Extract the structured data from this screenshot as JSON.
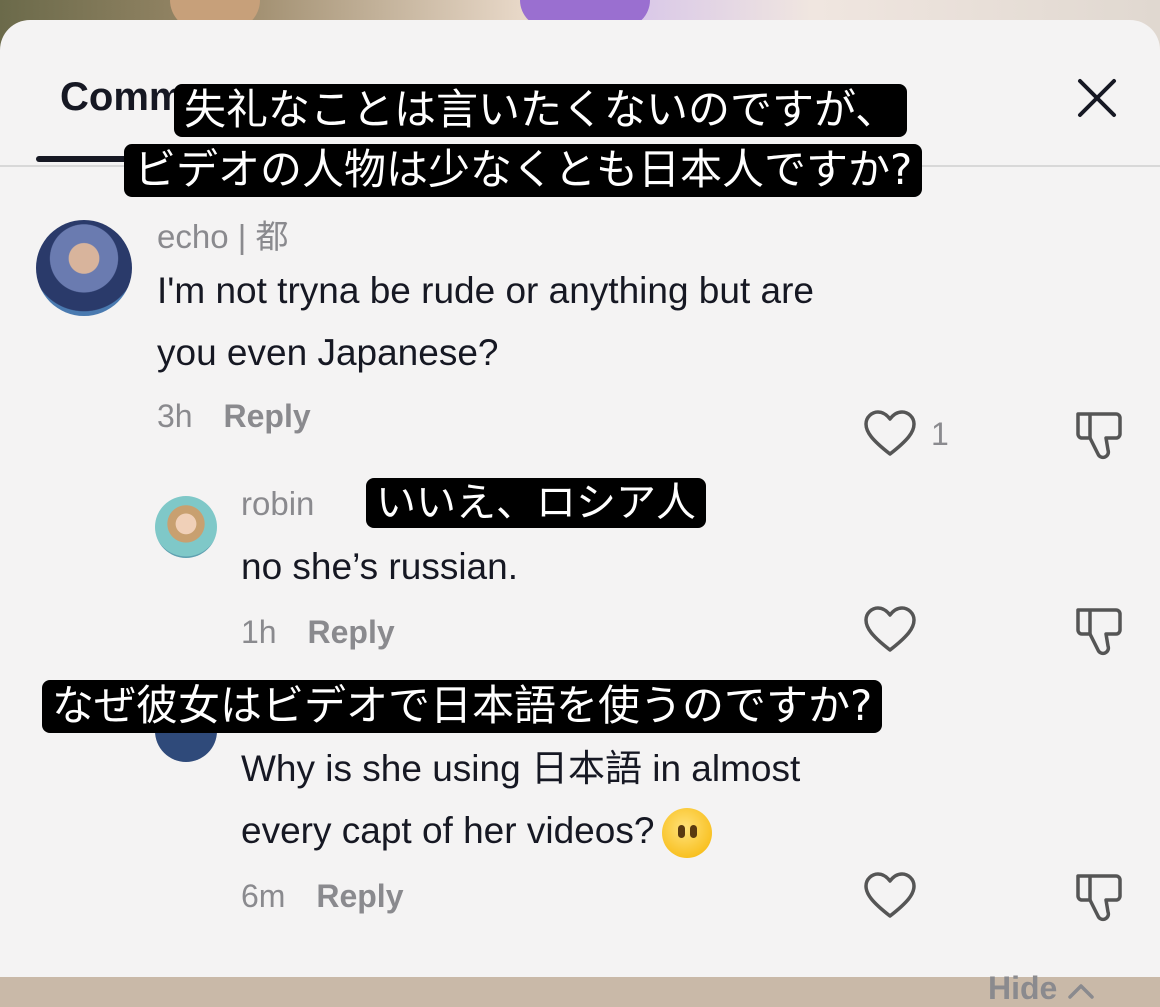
{
  "header": {
    "tab_label": "Comm"
  },
  "subtitles": [
    "失礼なことは言いたくないのですが、",
    "ビデオの人物は少なくとも日本人ですか?",
    "いいえ、ロシア人",
    "なぜ彼女はビデオで日本語を使うのですか?"
  ],
  "comments": [
    {
      "username": "echo | 都",
      "lines": [
        "I'm not tryna be rude or anything but are",
        "you even Japanese?"
      ],
      "time": "3h",
      "reply_label": "Reply",
      "likes": "1"
    },
    {
      "username": "robin",
      "lines": [
        "no she’s russian."
      ],
      "time": "1h",
      "reply_label": "Reply"
    },
    {
      "lines": [
        "Why is she using 日本語 in almost",
        "every capt of her videos?"
      ],
      "time": "6m",
      "reply_label": "Reply"
    }
  ],
  "hide_label": "Hide",
  "icons": [
    "close-icon",
    "heart-icon",
    "thumbs-down-icon",
    "chevron-up-icon",
    "neutral-face-emoji"
  ],
  "colors": {
    "sheet_bg": "#f4f3f3",
    "text": "#161823",
    "muted": "#8a8a8e"
  }
}
